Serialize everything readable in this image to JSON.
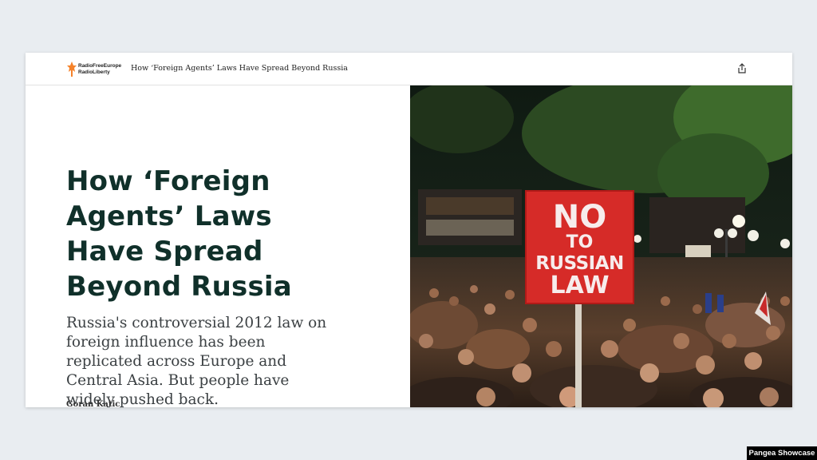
{
  "header": {
    "logo": {
      "line1": "RadioFreeEurope",
      "line2": "RadioLiberty",
      "accent": "#f5822a"
    },
    "title": "How ‘Foreign Agents’ Laws Have Spread Beyond Russia",
    "share_icon": "share-icon"
  },
  "article": {
    "headline": "How ‘Foreign Agents’ Laws Have Spread Beyond Russia",
    "summary": "Russia's controversial 2012 law on foreign influence has been replicated across Europe and Central Asia. But people have widely pushed back.",
    "author": "Goran Katic",
    "headline_color": "#10302a"
  },
  "photo": {
    "sign": {
      "line1": "NO",
      "line2": "TO",
      "line3": "RUSSIAN",
      "line4": "LAW",
      "color": "#d62b28"
    }
  },
  "watermark": "Pangea Showcase"
}
